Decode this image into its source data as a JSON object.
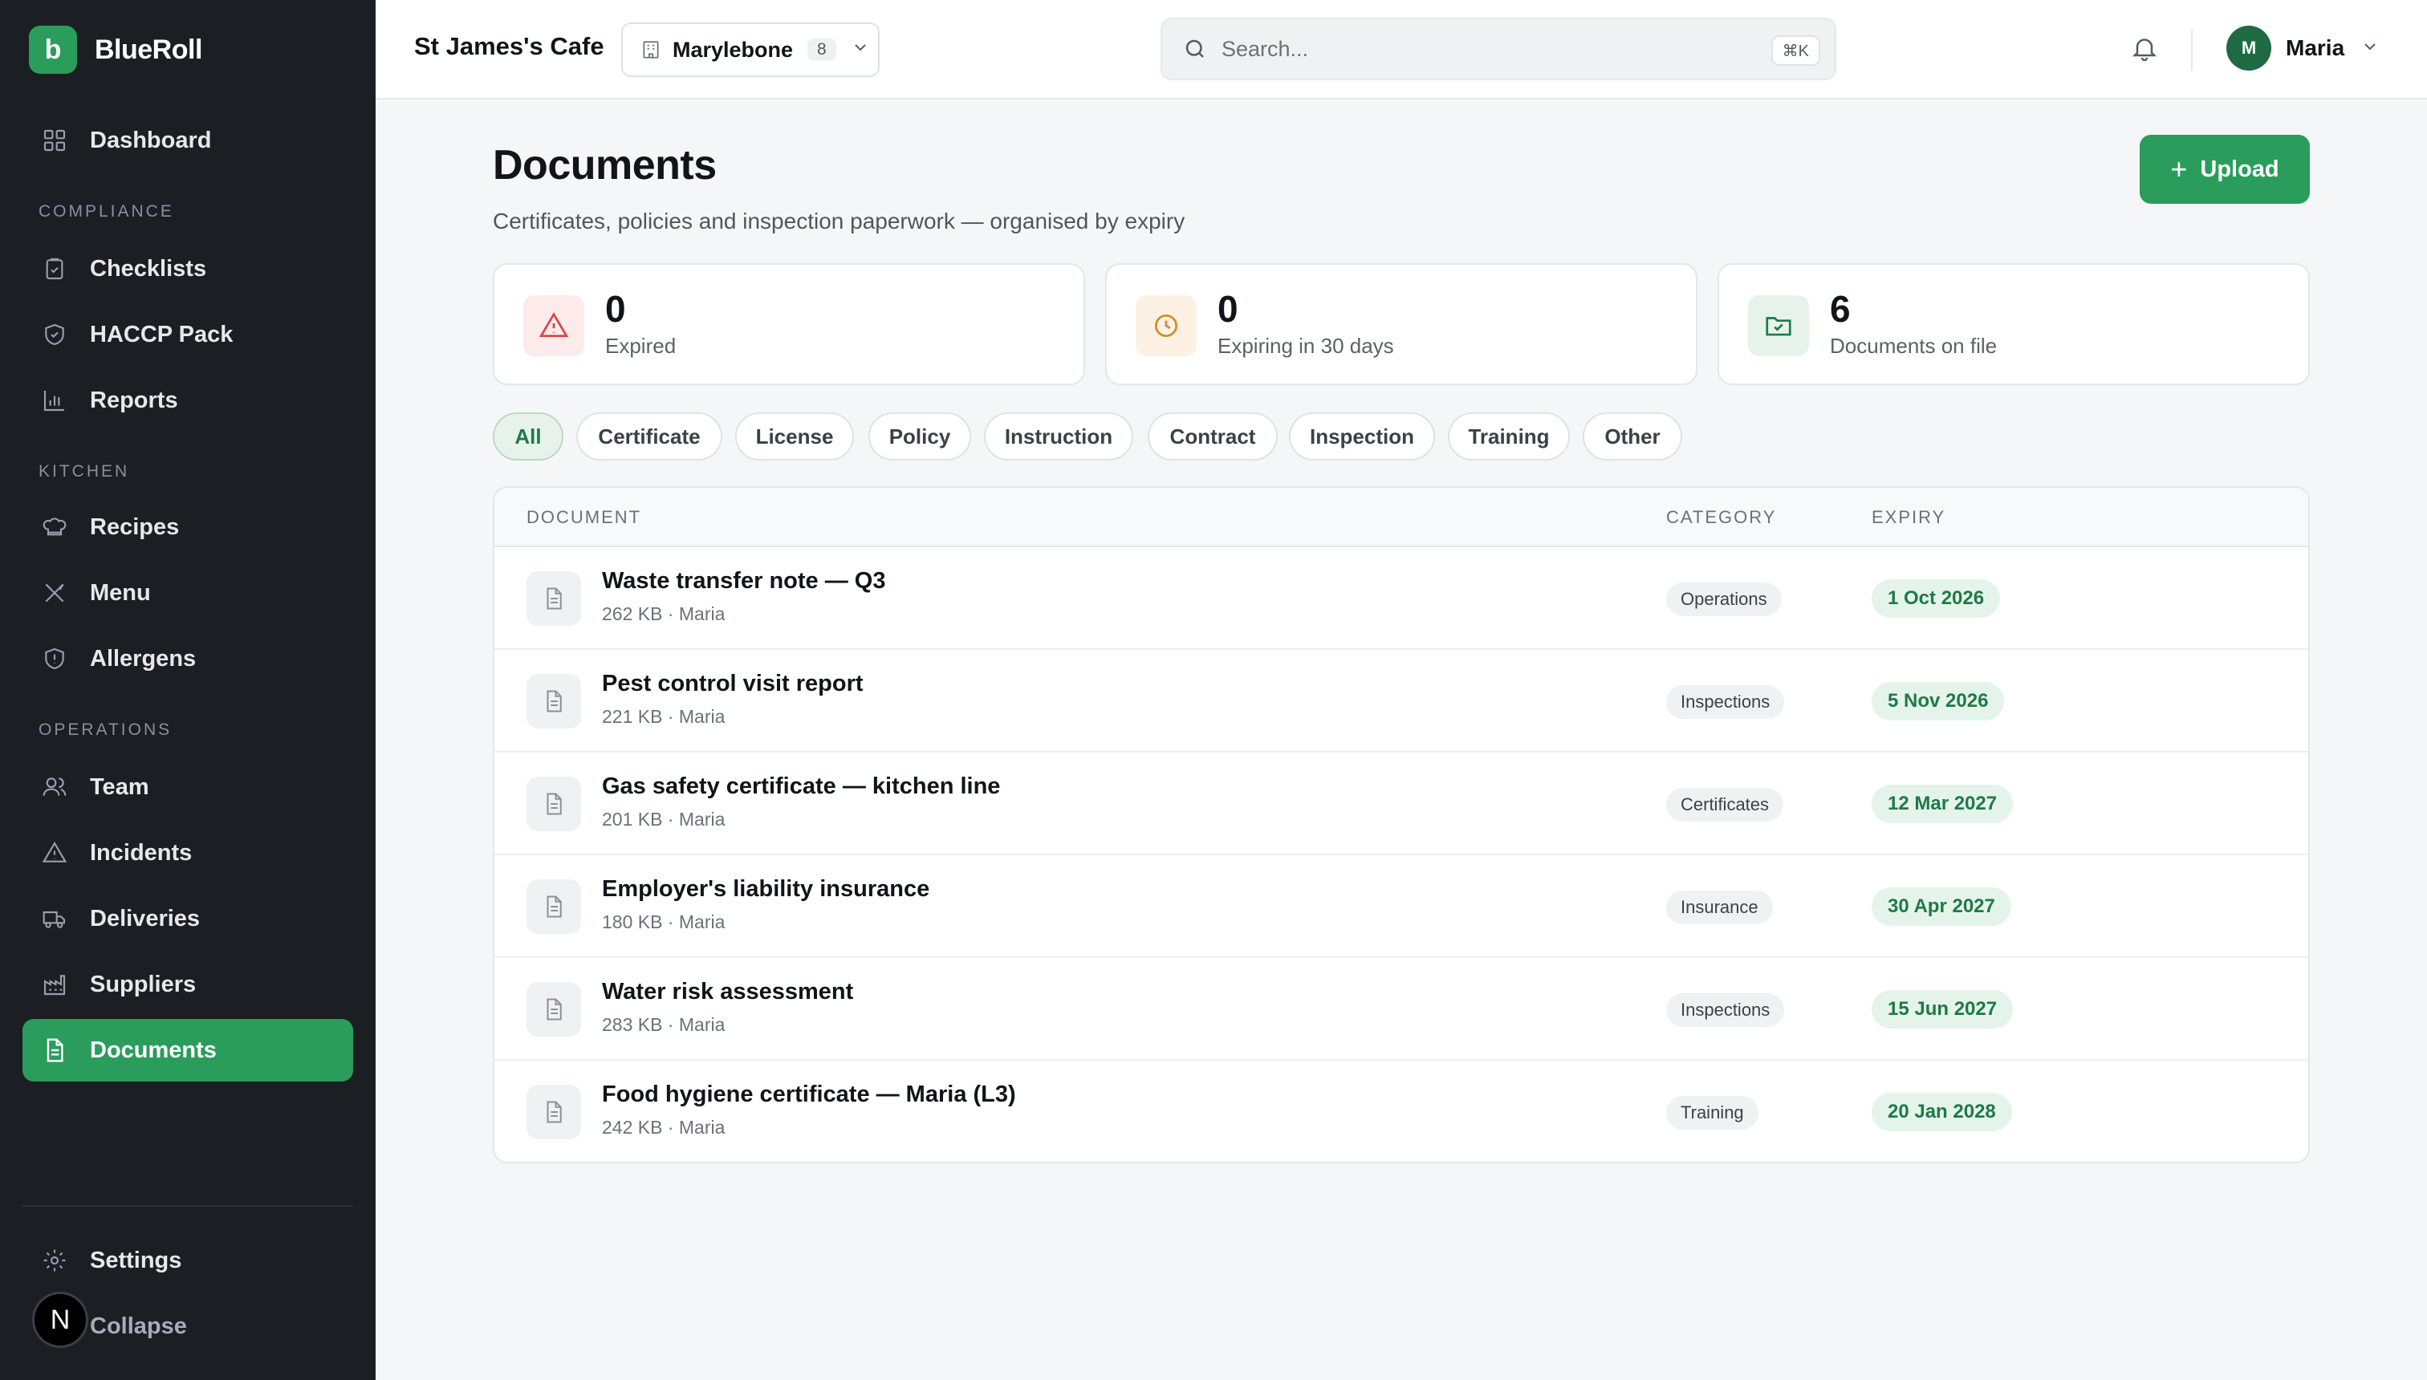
{
  "brand": {
    "logo_letter": "b",
    "name": "BlueRoll",
    "accent": "#2a9d5c"
  },
  "sidebar": {
    "sections": [
      "COMPLIANCE",
      "KITCHEN",
      "OPERATIONS"
    ],
    "items": [
      {
        "label": "Dashboard",
        "icon": "grid-icon"
      },
      {
        "label": "Checklists",
        "icon": "clipboard-check-icon"
      },
      {
        "label": "HACCP Pack",
        "icon": "shield-check-icon"
      },
      {
        "label": "Reports",
        "icon": "bar-chart-icon"
      },
      {
        "label": "Recipes",
        "icon": "chef-hat-icon"
      },
      {
        "label": "Menu",
        "icon": "utensils-icon"
      },
      {
        "label": "Allergens",
        "icon": "shield-alert-icon"
      },
      {
        "label": "Team",
        "icon": "users-icon"
      },
      {
        "label": "Incidents",
        "icon": "warning-triangle-icon"
      },
      {
        "label": "Deliveries",
        "icon": "truck-icon"
      },
      {
        "label": "Suppliers",
        "icon": "factory-icon"
      },
      {
        "label": "Documents",
        "icon": "document-icon",
        "active": true
      }
    ],
    "settings_label": "Settings",
    "collapse_label": "Collapse",
    "floating_badge": "N"
  },
  "header": {
    "cafe_name": "St James's Cafe",
    "location": {
      "name": "Marylebone",
      "count": "8"
    },
    "search": {
      "placeholder": "Search...",
      "shortcut": "⌘K"
    },
    "user": {
      "initial": "M",
      "name": "Maria"
    }
  },
  "page": {
    "title": "Documents",
    "subtitle": "Certificates, policies and inspection paperwork — organised by expiry",
    "upload_label": "Upload"
  },
  "stats": [
    {
      "value": "0",
      "label": "Expired",
      "icon": "warning-triangle-icon",
      "color": "#d64545"
    },
    {
      "value": "0",
      "label": "Expiring in 30 days",
      "icon": "clock-icon",
      "color": "#d68a1f"
    },
    {
      "value": "6",
      "label": "Documents on file",
      "icon": "folder-check-icon",
      "color": "#1e7a46"
    }
  ],
  "filters": [
    "All",
    "Certificate",
    "License",
    "Policy",
    "Instruction",
    "Contract",
    "Inspection",
    "Training",
    "Other"
  ],
  "active_filter": "All",
  "table": {
    "columns": [
      "DOCUMENT",
      "CATEGORY",
      "EXPIRY"
    ],
    "rows": [
      {
        "title": "Waste transfer note — Q3",
        "meta": "262 KB · Maria",
        "category": "Operations",
        "expiry": "1 Oct 2026"
      },
      {
        "title": "Pest control visit report",
        "meta": "221 KB · Maria",
        "category": "Inspections",
        "expiry": "5 Nov 2026"
      },
      {
        "title": "Gas safety certificate — kitchen line",
        "meta": "201 KB · Maria",
        "category": "Certificates",
        "expiry": "12 Mar 2027"
      },
      {
        "title": "Employer's liability insurance",
        "meta": "180 KB · Maria",
        "category": "Insurance",
        "expiry": "30 Apr 2027"
      },
      {
        "title": "Water risk assessment",
        "meta": "283 KB · Maria",
        "category": "Inspections",
        "expiry": "15 Jun 2027"
      },
      {
        "title": "Food hygiene certificate — Maria (L3)",
        "meta": "242 KB · Maria",
        "category": "Training",
        "expiry": "20 Jan 2028"
      }
    ]
  }
}
